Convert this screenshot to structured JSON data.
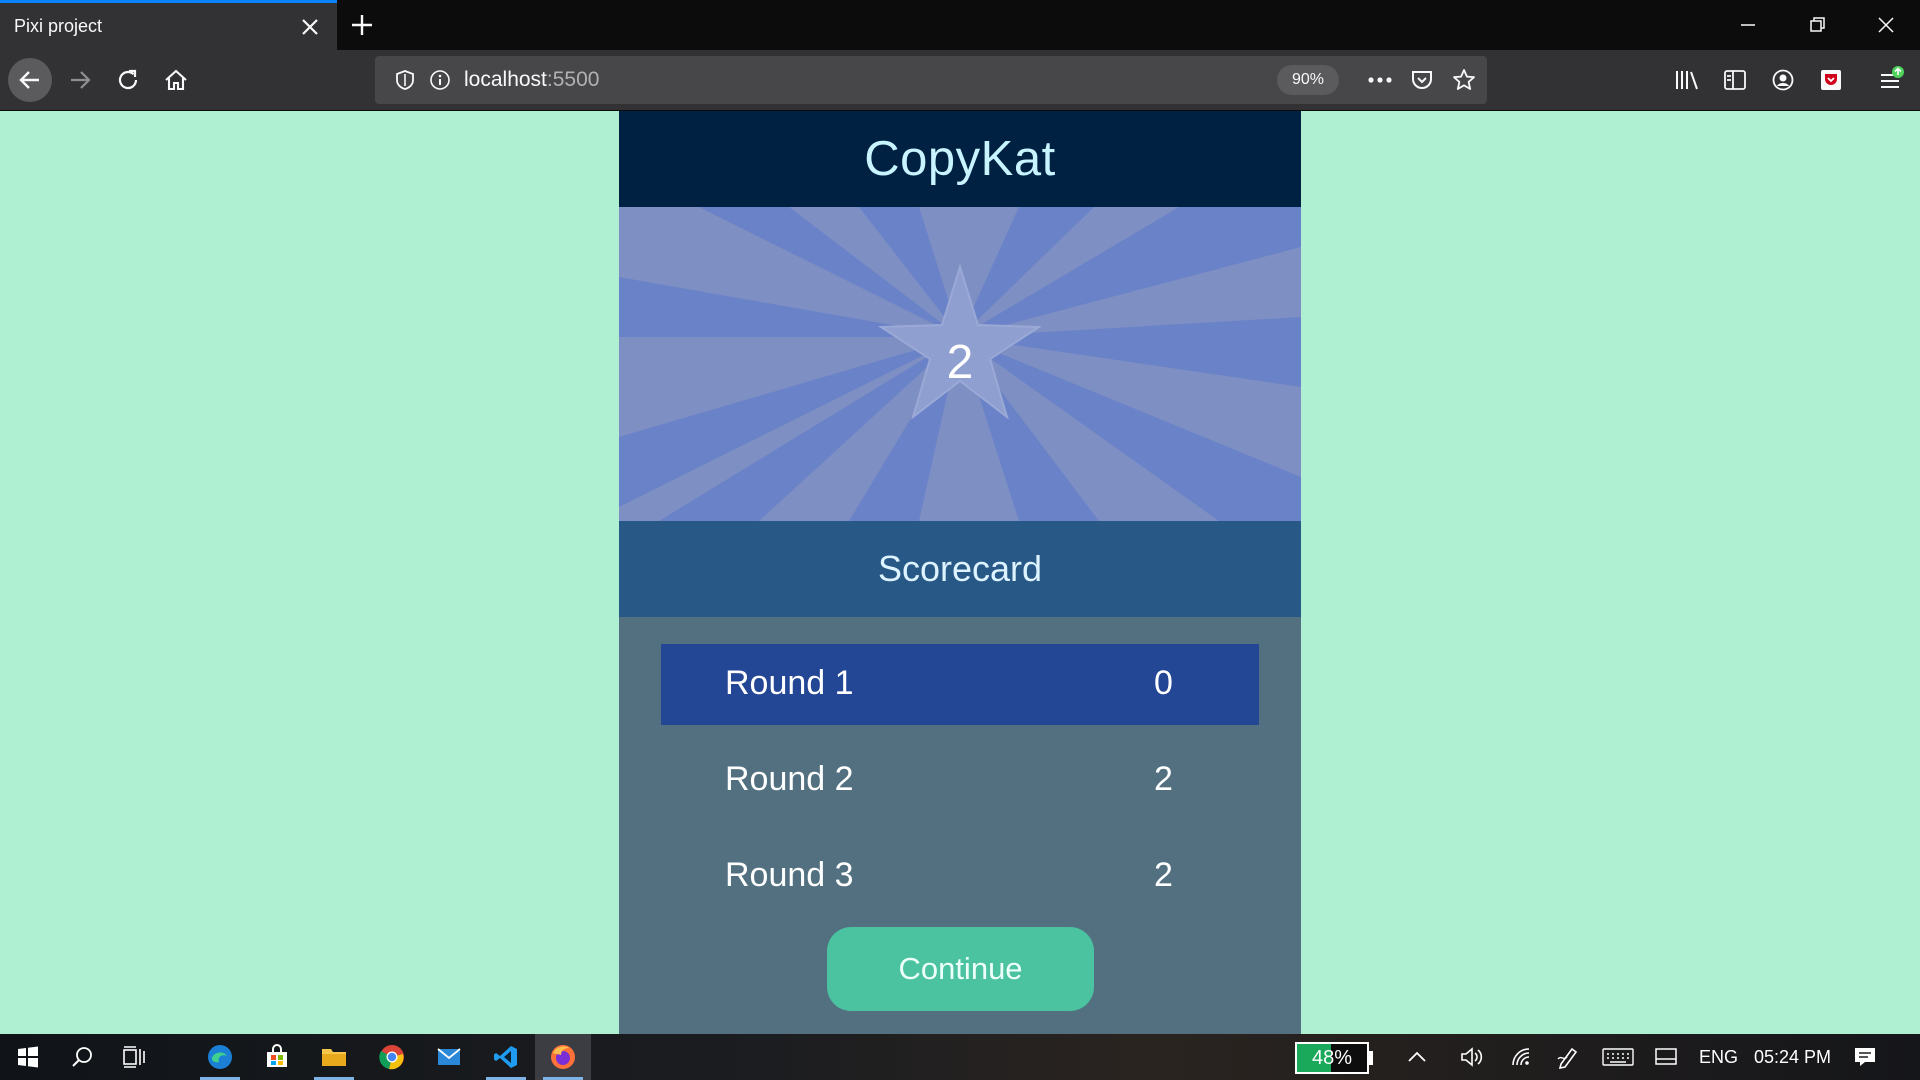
{
  "browser": {
    "tab_title": "Pixi project",
    "url_host": "localhost",
    "url_port": ":5500",
    "zoom": "90%"
  },
  "game": {
    "title": "CopyKat",
    "star_value": "2",
    "scorecard_title": "Scorecard",
    "rounds": [
      {
        "label": "Round 1",
        "value": "0"
      },
      {
        "label": "Round 2",
        "value": "2"
      },
      {
        "label": "Round 3",
        "value": "2"
      }
    ],
    "continue_label": "Continue"
  },
  "taskbar": {
    "battery": "48%",
    "battery_level": 0.48,
    "language": "ENG",
    "time": "05:24 PM"
  },
  "colors": {
    "page_background": "#aef0d1",
    "header": "#002142",
    "scorecard_header": "#285886",
    "active_round": "#234695",
    "continue_button": "#4bc2a0"
  }
}
